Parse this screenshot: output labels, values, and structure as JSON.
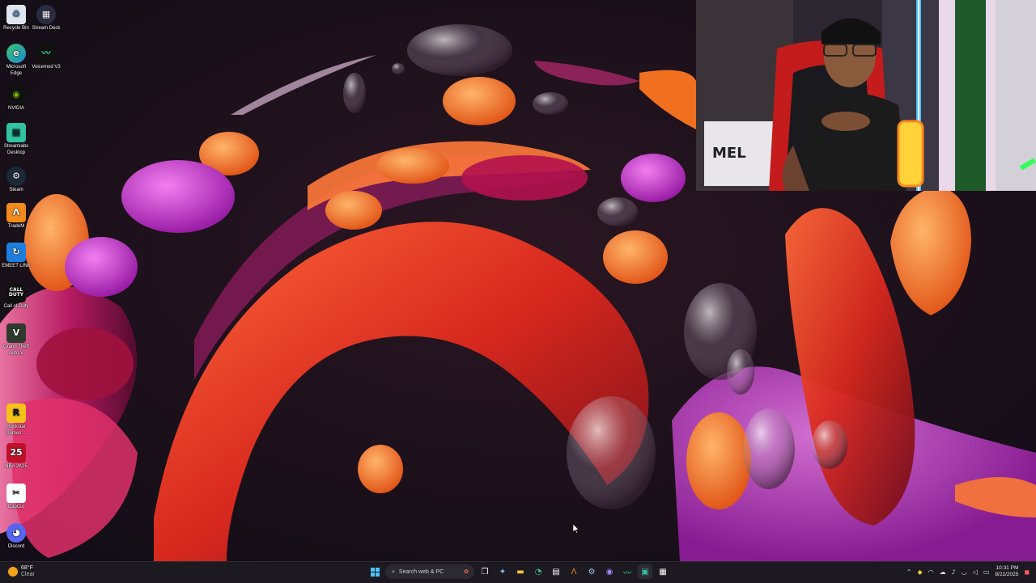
{
  "desktop": {
    "icons": [
      {
        "label": "Recycle Bin",
        "icon": "recycle-bin-icon"
      },
      {
        "label": "Stream Deck",
        "icon": "stream-deck-icon"
      },
      {
        "label": "Microsoft Edge",
        "icon": "edge-icon"
      },
      {
        "label": "Voicemod V3",
        "icon": "voicemod-icon"
      },
      {
        "label": "NVIDIA",
        "icon": "nvidia-icon"
      },
      {
        "label": "Streamlabs Desktop",
        "icon": "streamlabs-icon"
      },
      {
        "label": "Steam",
        "icon": "steam-icon"
      },
      {
        "label": "TradeM",
        "icon": "app-icon"
      },
      {
        "label": "EMEET LINK",
        "icon": "emeet-icon"
      },
      {
        "label": "Call of Duty",
        "icon": "call-of-duty-icon"
      },
      {
        "label": "Grand Theft Auto V",
        "icon": "gta-icon"
      },
      {
        "label": "Rockstar Games ...",
        "icon": "rockstar-icon"
      },
      {
        "label": "NBA 2K25",
        "icon": "nba2k25-icon"
      },
      {
        "label": "CapCut",
        "icon": "capcut-icon"
      },
      {
        "label": "Discord",
        "icon": "discord-icon"
      }
    ]
  },
  "taskbar": {
    "weather": {
      "temp": "68°F",
      "condition": "Clear"
    },
    "search_placeholder": "Search web & PC",
    "apps": [
      {
        "name": "task-view",
        "icon": "task-view-icon"
      },
      {
        "name": "copilot",
        "icon": "copilot-icon"
      },
      {
        "name": "file-explorer",
        "icon": "folder-icon"
      },
      {
        "name": "edge",
        "icon": "edge-icon"
      },
      {
        "name": "store",
        "icon": "store-icon"
      },
      {
        "name": "app",
        "icon": "app-icon"
      },
      {
        "name": "steam",
        "icon": "steam-icon"
      },
      {
        "name": "voicemod",
        "icon": "voicemod-icon"
      },
      {
        "name": "app",
        "icon": "app-icon"
      },
      {
        "name": "streamlabs",
        "icon": "streamlabs-icon"
      },
      {
        "name": "stream-deck",
        "icon": "stream-deck-icon"
      }
    ],
    "clock": {
      "time": "10:31 PM",
      "date": "8/22/2025"
    }
  },
  "colors": {
    "taskbar": "#1c1a20",
    "accent": "#0078d4"
  }
}
